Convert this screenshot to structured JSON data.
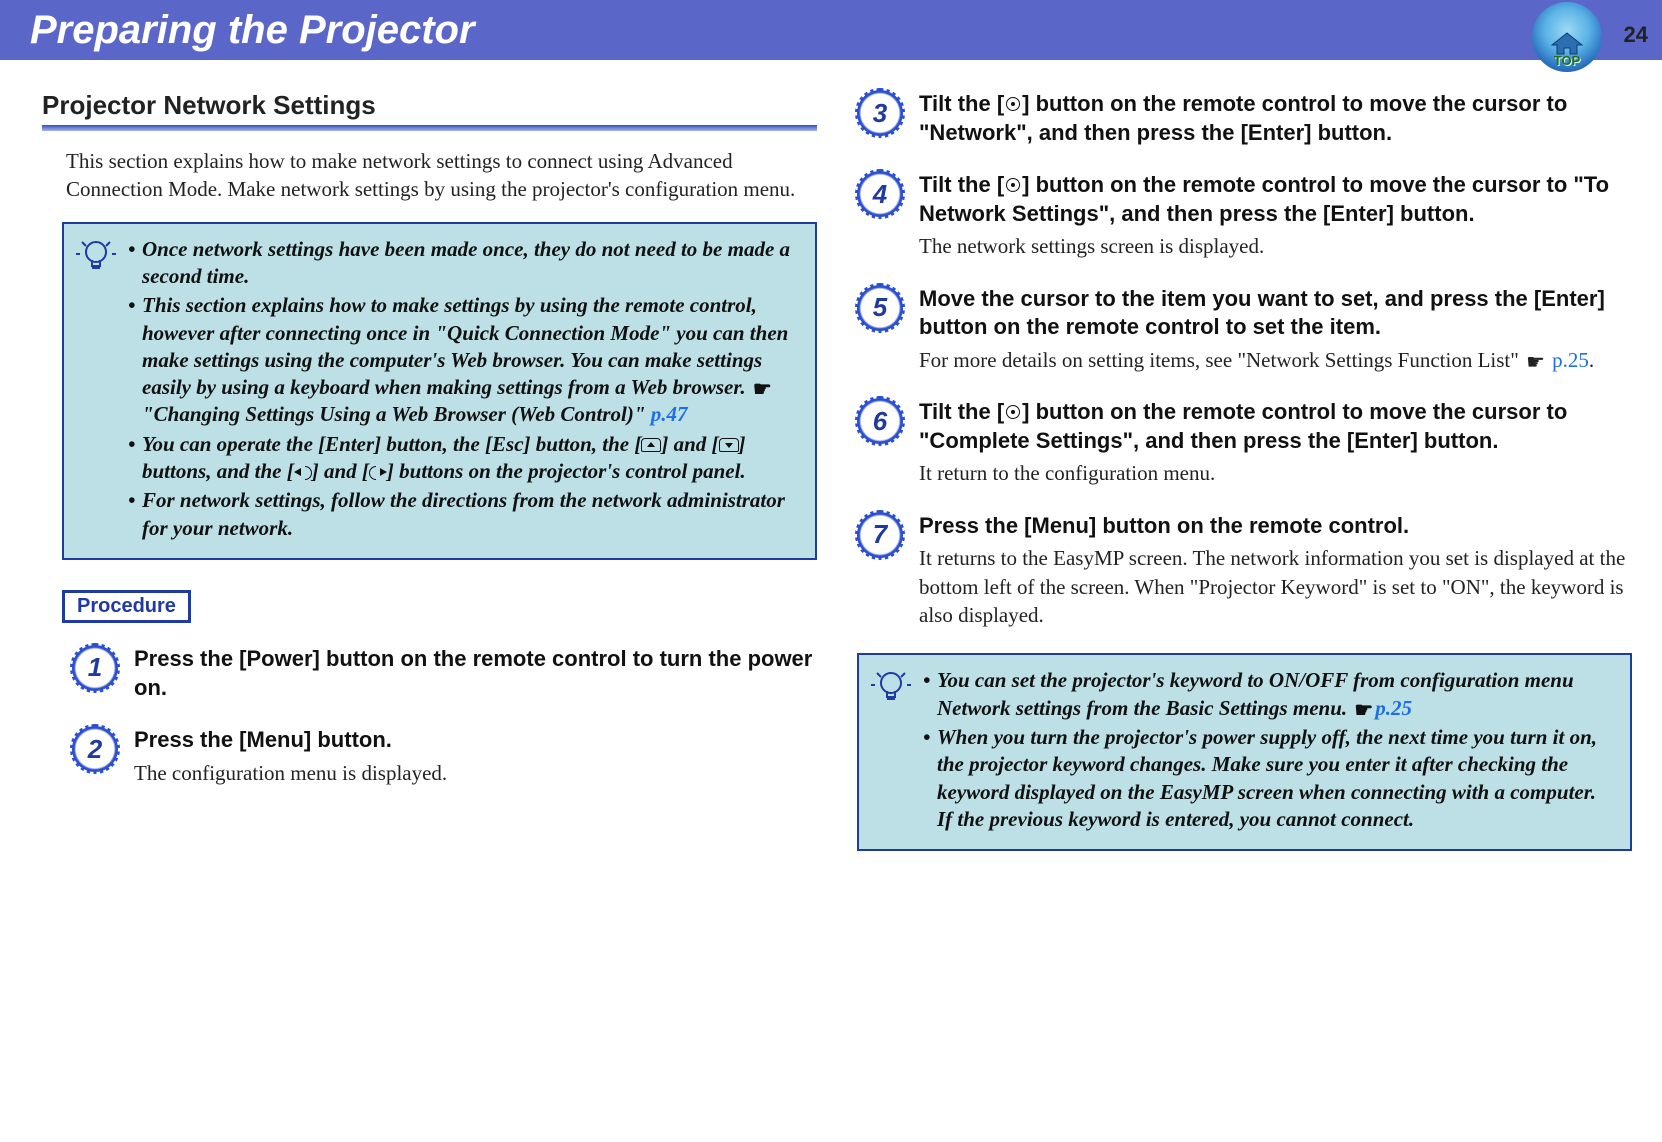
{
  "header": {
    "title": "Preparing the Projector",
    "page_number": "24",
    "top_label": "TOP"
  },
  "section": {
    "title": "Projector Network Settings",
    "intro": "This section explains how to make network settings to connect using Advanced Connection Mode. Make network settings by using the projector's configuration menu."
  },
  "tip1": {
    "b1": "Once network settings have been made once, they do not need to be made a second time.",
    "b2a": "This section explains how to make settings by using the remote control, however after connecting once in \"Quick Connection Mode\" you can then make settings using the computer's Web browser. You can make settings easily by using a keyboard when making settings from a Web browser. ",
    "b2b": "\"Changing Settings Using a Web Browser (Web Control)\" ",
    "b2link": "p.47",
    "b3a": "You can operate the [Enter] button, the [Esc] button, the [",
    "b3b": "] and [",
    "b3c": "] buttons, and the [",
    "b3d": "] and [",
    "b3e": "] buttons on the projector's control panel.",
    "b4": "For network settings, follow the directions from the network administrator for your network."
  },
  "procedure_label": "Procedure",
  "steps": {
    "s1": {
      "num": "1",
      "bold": "Press the [Power] button on the remote control to turn the power on."
    },
    "s2": {
      "num": "2",
      "bold": "Press the [Menu] button.",
      "sub": "The configuration menu is displayed."
    },
    "s3": {
      "num": "3",
      "bold_a": "Tilt the [",
      "bold_b": "] button on the remote control to move the cursor to \"Network\", and then press the [Enter] button."
    },
    "s4": {
      "num": "4",
      "bold_a": "Tilt the [",
      "bold_b": "] button on the remote control to move the cursor to \"To Network Settings\", and then press the [Enter] button.",
      "sub": "The network settings screen is displayed."
    },
    "s5": {
      "num": "5",
      "bold": "Move the cursor to the item you want to set, and press the [Enter] button on the remote control to set the item.",
      "sub_a": "For more details on setting items, see \"Network Settings Function List\" ",
      "sub_link": "p.25",
      "sub_b": "."
    },
    "s6": {
      "num": "6",
      "bold_a": "Tilt the [",
      "bold_b": "] button on the remote control to move the cursor to \"Complete Settings\", and then press the [Enter] button.",
      "sub": "It return to the configuration menu."
    },
    "s7": {
      "num": "7",
      "bold": "Press the [Menu] button on the remote control.",
      "sub": "It returns to the EasyMP screen. The network information you set is displayed at the bottom left of the screen. When \"Projector Keyword\" is set to \"ON\", the keyword is also displayed."
    }
  },
  "tip2": {
    "b1a": "You can set the projector's keyword to ON/OFF from configuration menu Network settings from the Basic Settings menu. ",
    "b1link": "p.25",
    "b2": "When you turn the projector's power supply off, the next time you turn it on, the projector keyword changes. Make sure you enter it after checking the keyword displayed on the EasyMP screen when connecting with a computer. If the previous keyword is entered, you cannot connect."
  }
}
